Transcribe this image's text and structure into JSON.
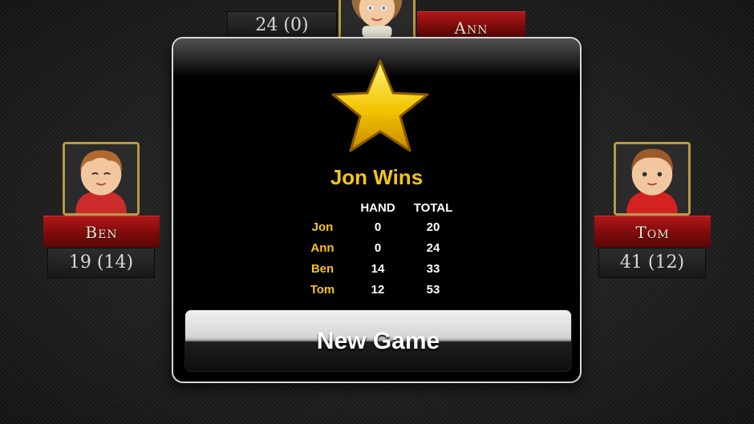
{
  "players": {
    "top": {
      "name": "Ann",
      "score": "24 (0)"
    },
    "left": {
      "name": "Ben",
      "score": "19 (14)"
    },
    "right": {
      "name": "Tom",
      "score": "41 (12)"
    }
  },
  "dialog": {
    "winner_text": "Jon Wins",
    "headers": {
      "hand": "HAND",
      "total": "TOTAL"
    },
    "rows": [
      {
        "name": "Jon",
        "hand": "0",
        "total": "20"
      },
      {
        "name": "Ann",
        "hand": "0",
        "total": "24"
      },
      {
        "name": "Ben",
        "hand": "14",
        "total": "33"
      },
      {
        "name": "Tom",
        "hand": "12",
        "total": "53"
      }
    ],
    "button_label": "New Game",
    "icon": "star-icon"
  },
  "colors": {
    "accent_gold": "#f5c518",
    "plate_red": "#8b0f0f",
    "frame_gold": "#b59a47"
  }
}
